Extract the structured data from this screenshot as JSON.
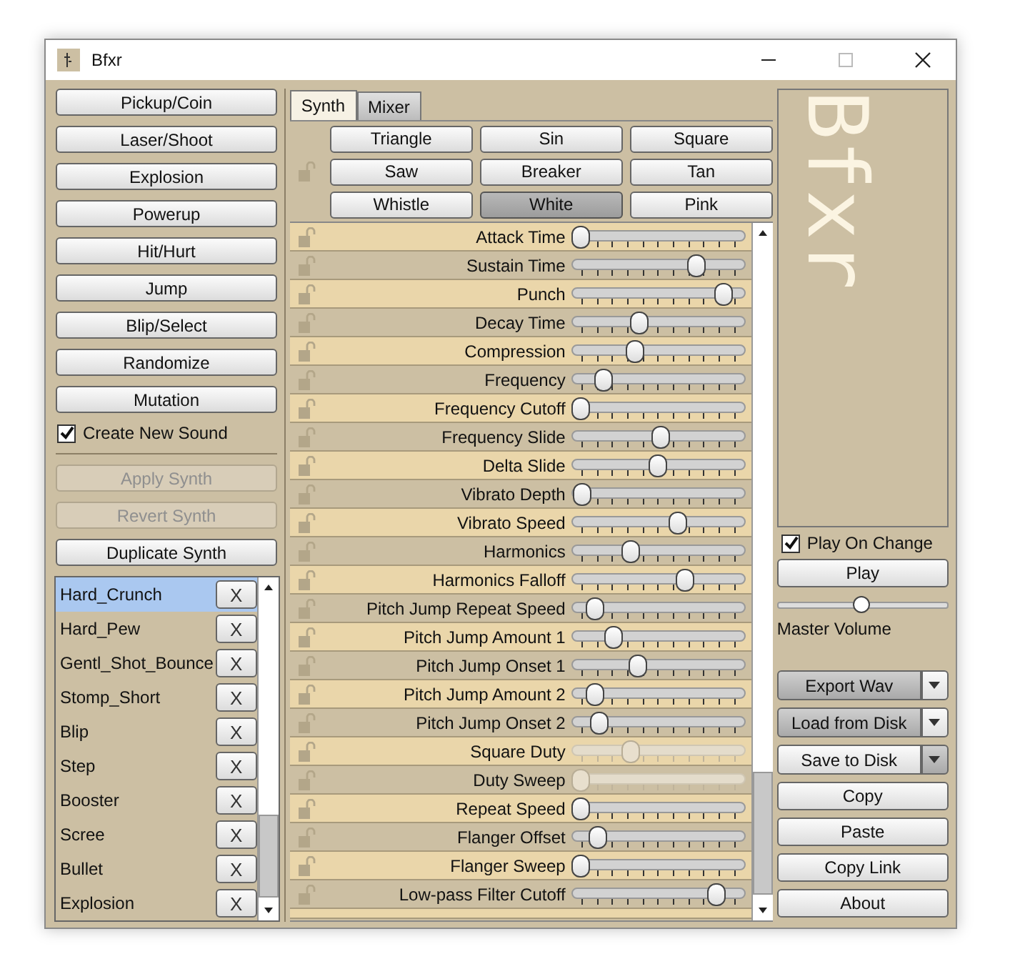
{
  "window": {
    "title": "Bfxr"
  },
  "presets": [
    "Pickup/Coin",
    "Laser/Shoot",
    "Explosion",
    "Powerup",
    "Hit/Hurt",
    "Jump",
    "Blip/Select",
    "Randomize",
    "Mutation"
  ],
  "create_new_sound": {
    "label": "Create New Sound",
    "checked": true
  },
  "synth_buttons": [
    {
      "label": "Apply Synth",
      "disabled": true
    },
    {
      "label": "Revert Synth",
      "disabled": true
    },
    {
      "label": "Duplicate Synth",
      "disabled": false
    }
  ],
  "sounds": [
    {
      "name": "Hard_Crunch",
      "selected": true,
      "delete": "X"
    },
    {
      "name": "Hard_Pew",
      "selected": false,
      "delete": "X"
    },
    {
      "name": "Gentl_Shot_Bounce",
      "selected": false,
      "delete": "X"
    },
    {
      "name": "Stomp_Short",
      "selected": false,
      "delete": "X"
    },
    {
      "name": "Blip",
      "selected": false,
      "delete": "X"
    },
    {
      "name": "Step",
      "selected": false,
      "delete": "X"
    },
    {
      "name": "Booster",
      "selected": false,
      "delete": "X"
    },
    {
      "name": "Scree",
      "selected": false,
      "delete": "X"
    },
    {
      "name": "Bullet",
      "selected": false,
      "delete": "X"
    },
    {
      "name": "Explosion",
      "selected": false,
      "delete": "X"
    }
  ],
  "tabs": [
    {
      "label": "Synth",
      "selected": true
    },
    {
      "label": "Mixer",
      "selected": false
    }
  ],
  "waveforms": [
    {
      "label": "Triangle",
      "selected": false
    },
    {
      "label": "Sin",
      "selected": false
    },
    {
      "label": "Square",
      "selected": false
    },
    {
      "label": "Saw",
      "selected": false
    },
    {
      "label": "Breaker",
      "selected": false
    },
    {
      "label": "Tan",
      "selected": false
    },
    {
      "label": "Whistle",
      "selected": false
    },
    {
      "label": "White",
      "selected": true
    },
    {
      "label": "Pink",
      "selected": false
    }
  ],
  "params": [
    {
      "label": "Attack Time",
      "level": 0,
      "disabled": false
    },
    {
      "label": "Sustain Time",
      "level": 0.75,
      "disabled": false
    },
    {
      "label": "Punch",
      "level": 0.93,
      "disabled": false
    },
    {
      "label": "Decay Time",
      "level": 0.38,
      "disabled": false
    },
    {
      "label": "Compression",
      "level": 0.35,
      "disabled": false
    },
    {
      "label": "Frequency",
      "level": 0.15,
      "disabled": false
    },
    {
      "label": "Frequency Cutoff",
      "level": 0,
      "disabled": false
    },
    {
      "label": "Frequency Slide",
      "level": 0.52,
      "disabled": false
    },
    {
      "label": "Delta Slide",
      "level": 0.5,
      "disabled": false
    },
    {
      "label": "Vibrato Depth",
      "level": 0.01,
      "disabled": false
    },
    {
      "label": "Vibrato Speed",
      "level": 0.63,
      "disabled": false
    },
    {
      "label": "Harmonics",
      "level": 0.33,
      "disabled": false
    },
    {
      "label": "Harmonics Falloff",
      "level": 0.68,
      "disabled": false
    },
    {
      "label": "Pitch Jump Repeat Speed",
      "level": 0.09,
      "disabled": false
    },
    {
      "label": "Pitch Jump Amount 1",
      "level": 0.21,
      "disabled": false
    },
    {
      "label": "Pitch Jump Onset 1",
      "level": 0.37,
      "disabled": false
    },
    {
      "label": "Pitch Jump Amount 2",
      "level": 0.09,
      "disabled": false
    },
    {
      "label": "Pitch Jump Onset 2",
      "level": 0.12,
      "disabled": false
    },
    {
      "label": "Square Duty",
      "level": 0.33,
      "disabled": true
    },
    {
      "label": "Duty Sweep",
      "level": 0,
      "disabled": true
    },
    {
      "label": "Repeat Speed",
      "level": 0,
      "disabled": false
    },
    {
      "label": "Flanger Offset",
      "level": 0.11,
      "disabled": false
    },
    {
      "label": "Flanger Sweep",
      "level": 0,
      "disabled": false
    },
    {
      "label": "Low-pass Filter Cutoff",
      "level": 0.88,
      "disabled": false
    }
  ],
  "logo": "Bfxr",
  "play_on_change": {
    "label": "Play On Change",
    "checked": true
  },
  "play_button": "Play",
  "master_volume": {
    "label": "Master Volume",
    "level": 0.5
  },
  "file_buttons": [
    {
      "label": "Export Wav",
      "kind": "split",
      "highlighted": true
    },
    {
      "label": "Load from Disk",
      "kind": "split",
      "highlighted": true
    },
    {
      "label": "Save to Disk",
      "kind": "split",
      "highlighted": false
    },
    {
      "label": "Copy",
      "kind": "plain",
      "highlighted": false
    },
    {
      "label": "Paste",
      "kind": "plain",
      "highlighted": false
    },
    {
      "label": "Copy Link",
      "kind": "plain",
      "highlighted": false
    },
    {
      "label": "About",
      "kind": "plain",
      "highlighted": false
    }
  ]
}
